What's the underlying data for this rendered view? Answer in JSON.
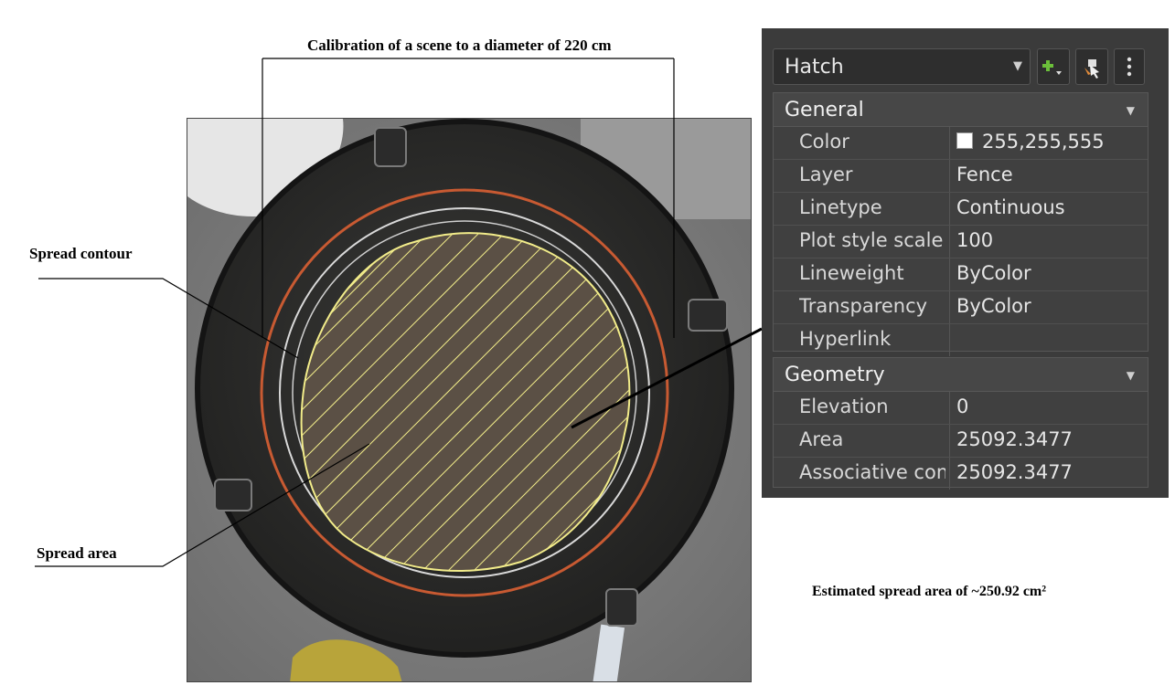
{
  "figure": {
    "calibration_title": "Calibration of a scene to a diameter of 220 cm",
    "spread_contour_label": "Spread contour",
    "spread_area_label": "Spread area",
    "estimate_label": "Estimated spread area of ~250.92 cm²"
  },
  "panel": {
    "selector_value": "Hatch",
    "sections": {
      "general": {
        "title": "General",
        "rows": [
          {
            "name": "Color",
            "value": "255,255,555"
          },
          {
            "name": "Layer",
            "value": "Fence"
          },
          {
            "name": "Linetype",
            "value": "Continuous"
          },
          {
            "name": "Plot style scale",
            "value": "100"
          },
          {
            "name": "Lineweight",
            "value": "ByColor"
          },
          {
            "name": "Transparency",
            "value": "ByColor"
          },
          {
            "name": "Hyperlink",
            "value": ""
          }
        ]
      },
      "geometry": {
        "title": "Geometry",
        "rows": [
          {
            "name": "Elevation",
            "value": "0"
          },
          {
            "name": "Area",
            "value": "25092.3477"
          },
          {
            "name": "Associative con",
            "value": "25092.3477"
          }
        ]
      }
    },
    "icons": [
      "dropdown-caret-icon",
      "quick-select-icon",
      "select-objects-icon",
      "more-options-icon",
      "collapse-caret-icon"
    ],
    "colors": {
      "panel_bg": "#3b3b3b",
      "swatch": "#ffffff",
      "hatch_contour": "#f2ec8a",
      "calibration_ring": "#c85a32"
    }
  }
}
